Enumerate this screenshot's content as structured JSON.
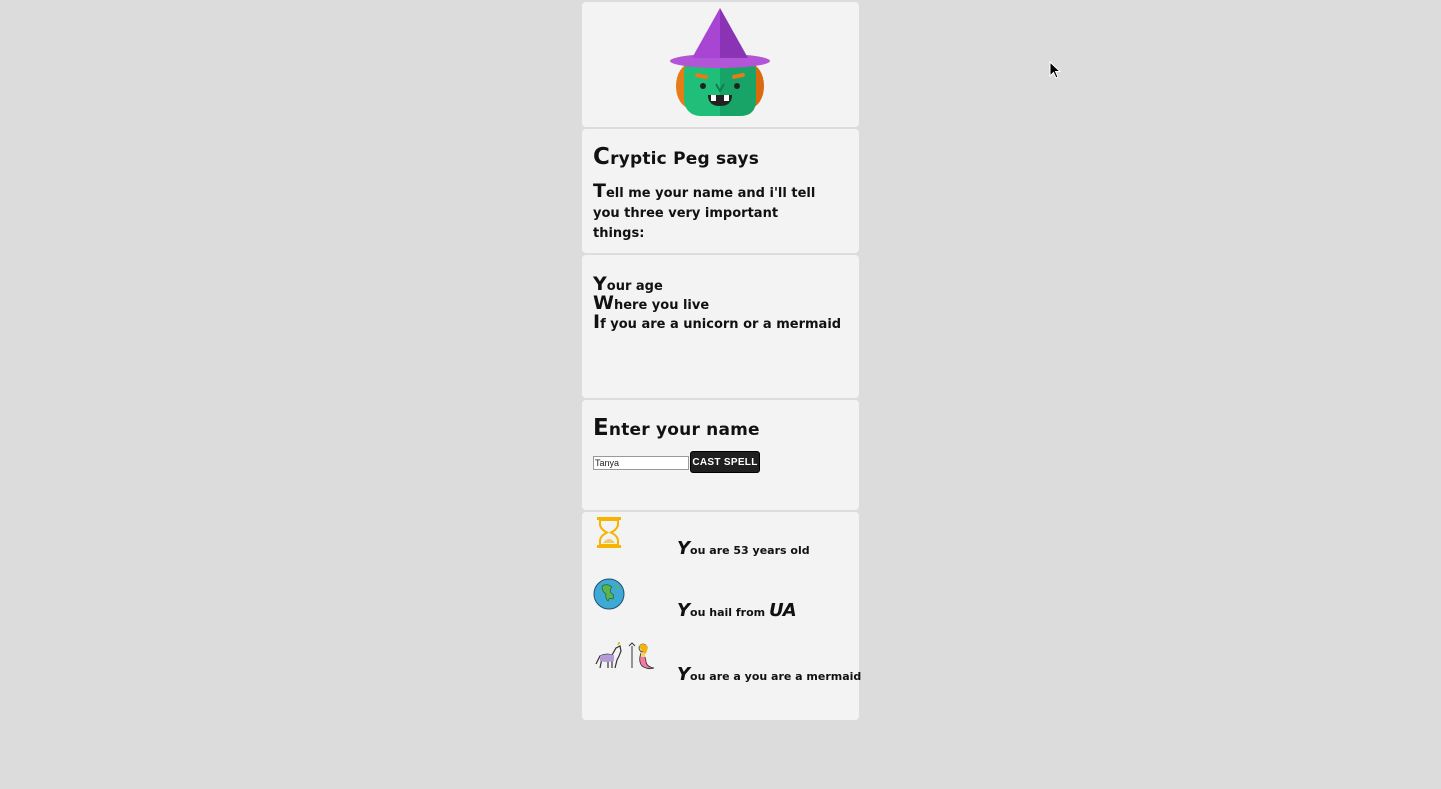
{
  "intro": {
    "title": "Cryptic Peg says",
    "message": "Tell me your name and i'll tell you three very important things:"
  },
  "list": {
    "items": [
      "Your age",
      "Where you live",
      "If you are a unicorn or a mermaid"
    ]
  },
  "form": {
    "title": "Enter your name",
    "name_value": "Tanya",
    "button_label": "CAST SPELL"
  },
  "results": {
    "age": {
      "first": "Y",
      "rest": "ou are 53 years old"
    },
    "place": {
      "first": "Y",
      "rest": "ou hail from ",
      "country": "UA"
    },
    "creature": {
      "first": "Y",
      "rest": "ou are a you are a mermaid"
    }
  },
  "icons": {
    "hero": "witch-face-icon",
    "age": "hourglass-icon",
    "place": "earth-globe-icon",
    "creature": "unicorn-mermaid-icon"
  },
  "colors": {
    "page_background": "#dcdcdc",
    "card_background": "#f3f3f3",
    "button_background": "#1f1f1f",
    "hat_purple": "#9b3fc4",
    "skin_green": "#1fbf79"
  }
}
